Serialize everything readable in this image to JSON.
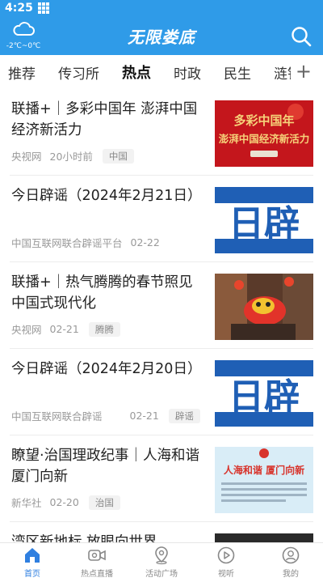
{
  "status": {
    "time": "4:25"
  },
  "header": {
    "title": "无限娄底",
    "weather_temp": "-2℃~0℃"
  },
  "tabs": [
    "推荐",
    "传习所",
    "热点",
    "时政",
    "民生",
    "涟钢"
  ],
  "tab_active": "热点",
  "tab_add": "+",
  "feed": [
    {
      "title": "联播+｜多彩中国年 澎湃中国经济新活力",
      "source": "央视网",
      "time": "20小时前",
      "tag": "中国",
      "thumb": "red-banner",
      "thumb_text_1": "多彩中国年",
      "thumb_text_2": "澎湃中国经济新活力"
    },
    {
      "title": "今日辟谣（2024年2月21日）",
      "source": "中国互联网联合辟谣平台",
      "time": "02-22",
      "tag": "",
      "thumb": "rumor",
      "thumb_text_1": "日辟"
    },
    {
      "title": "联播+｜热气腾腾的春节照见中国式现代化",
      "source": "央视网",
      "time": "02-21",
      "tag": "腾腾",
      "thumb": "lion-dance"
    },
    {
      "title": "今日辟谣（2024年2月20日）",
      "source": "中国互联网联合辟谣",
      "time": "02-21",
      "tag": "辟谣",
      "thumb": "rumor",
      "thumb_text_1": "日辟"
    },
    {
      "title": "瞭望·治国理政纪事｜人海和谐 厦门向新",
      "source": "新华社",
      "time": "02-20",
      "tag": "治国",
      "thumb": "xiamen",
      "thumb_text_1": "人海和谐  厦门向新"
    },
    {
      "title": "湾区新地标 放眼向世界",
      "source": "",
      "time": "",
      "tag": "",
      "thumb": "dark"
    }
  ],
  "bottom_nav": [
    {
      "label": "首页",
      "icon": "home-icon",
      "active": true
    },
    {
      "label": "热点直播",
      "icon": "live-camera-icon",
      "active": false
    },
    {
      "label": "活动广场",
      "icon": "location-pin-icon",
      "active": false
    },
    {
      "label": "视听",
      "icon": "play-circle-icon",
      "active": false
    },
    {
      "label": "我的",
      "icon": "user-icon",
      "active": false
    }
  ],
  "colors": {
    "brand": "#2f9be8",
    "active_nav": "#2f7fe0"
  }
}
